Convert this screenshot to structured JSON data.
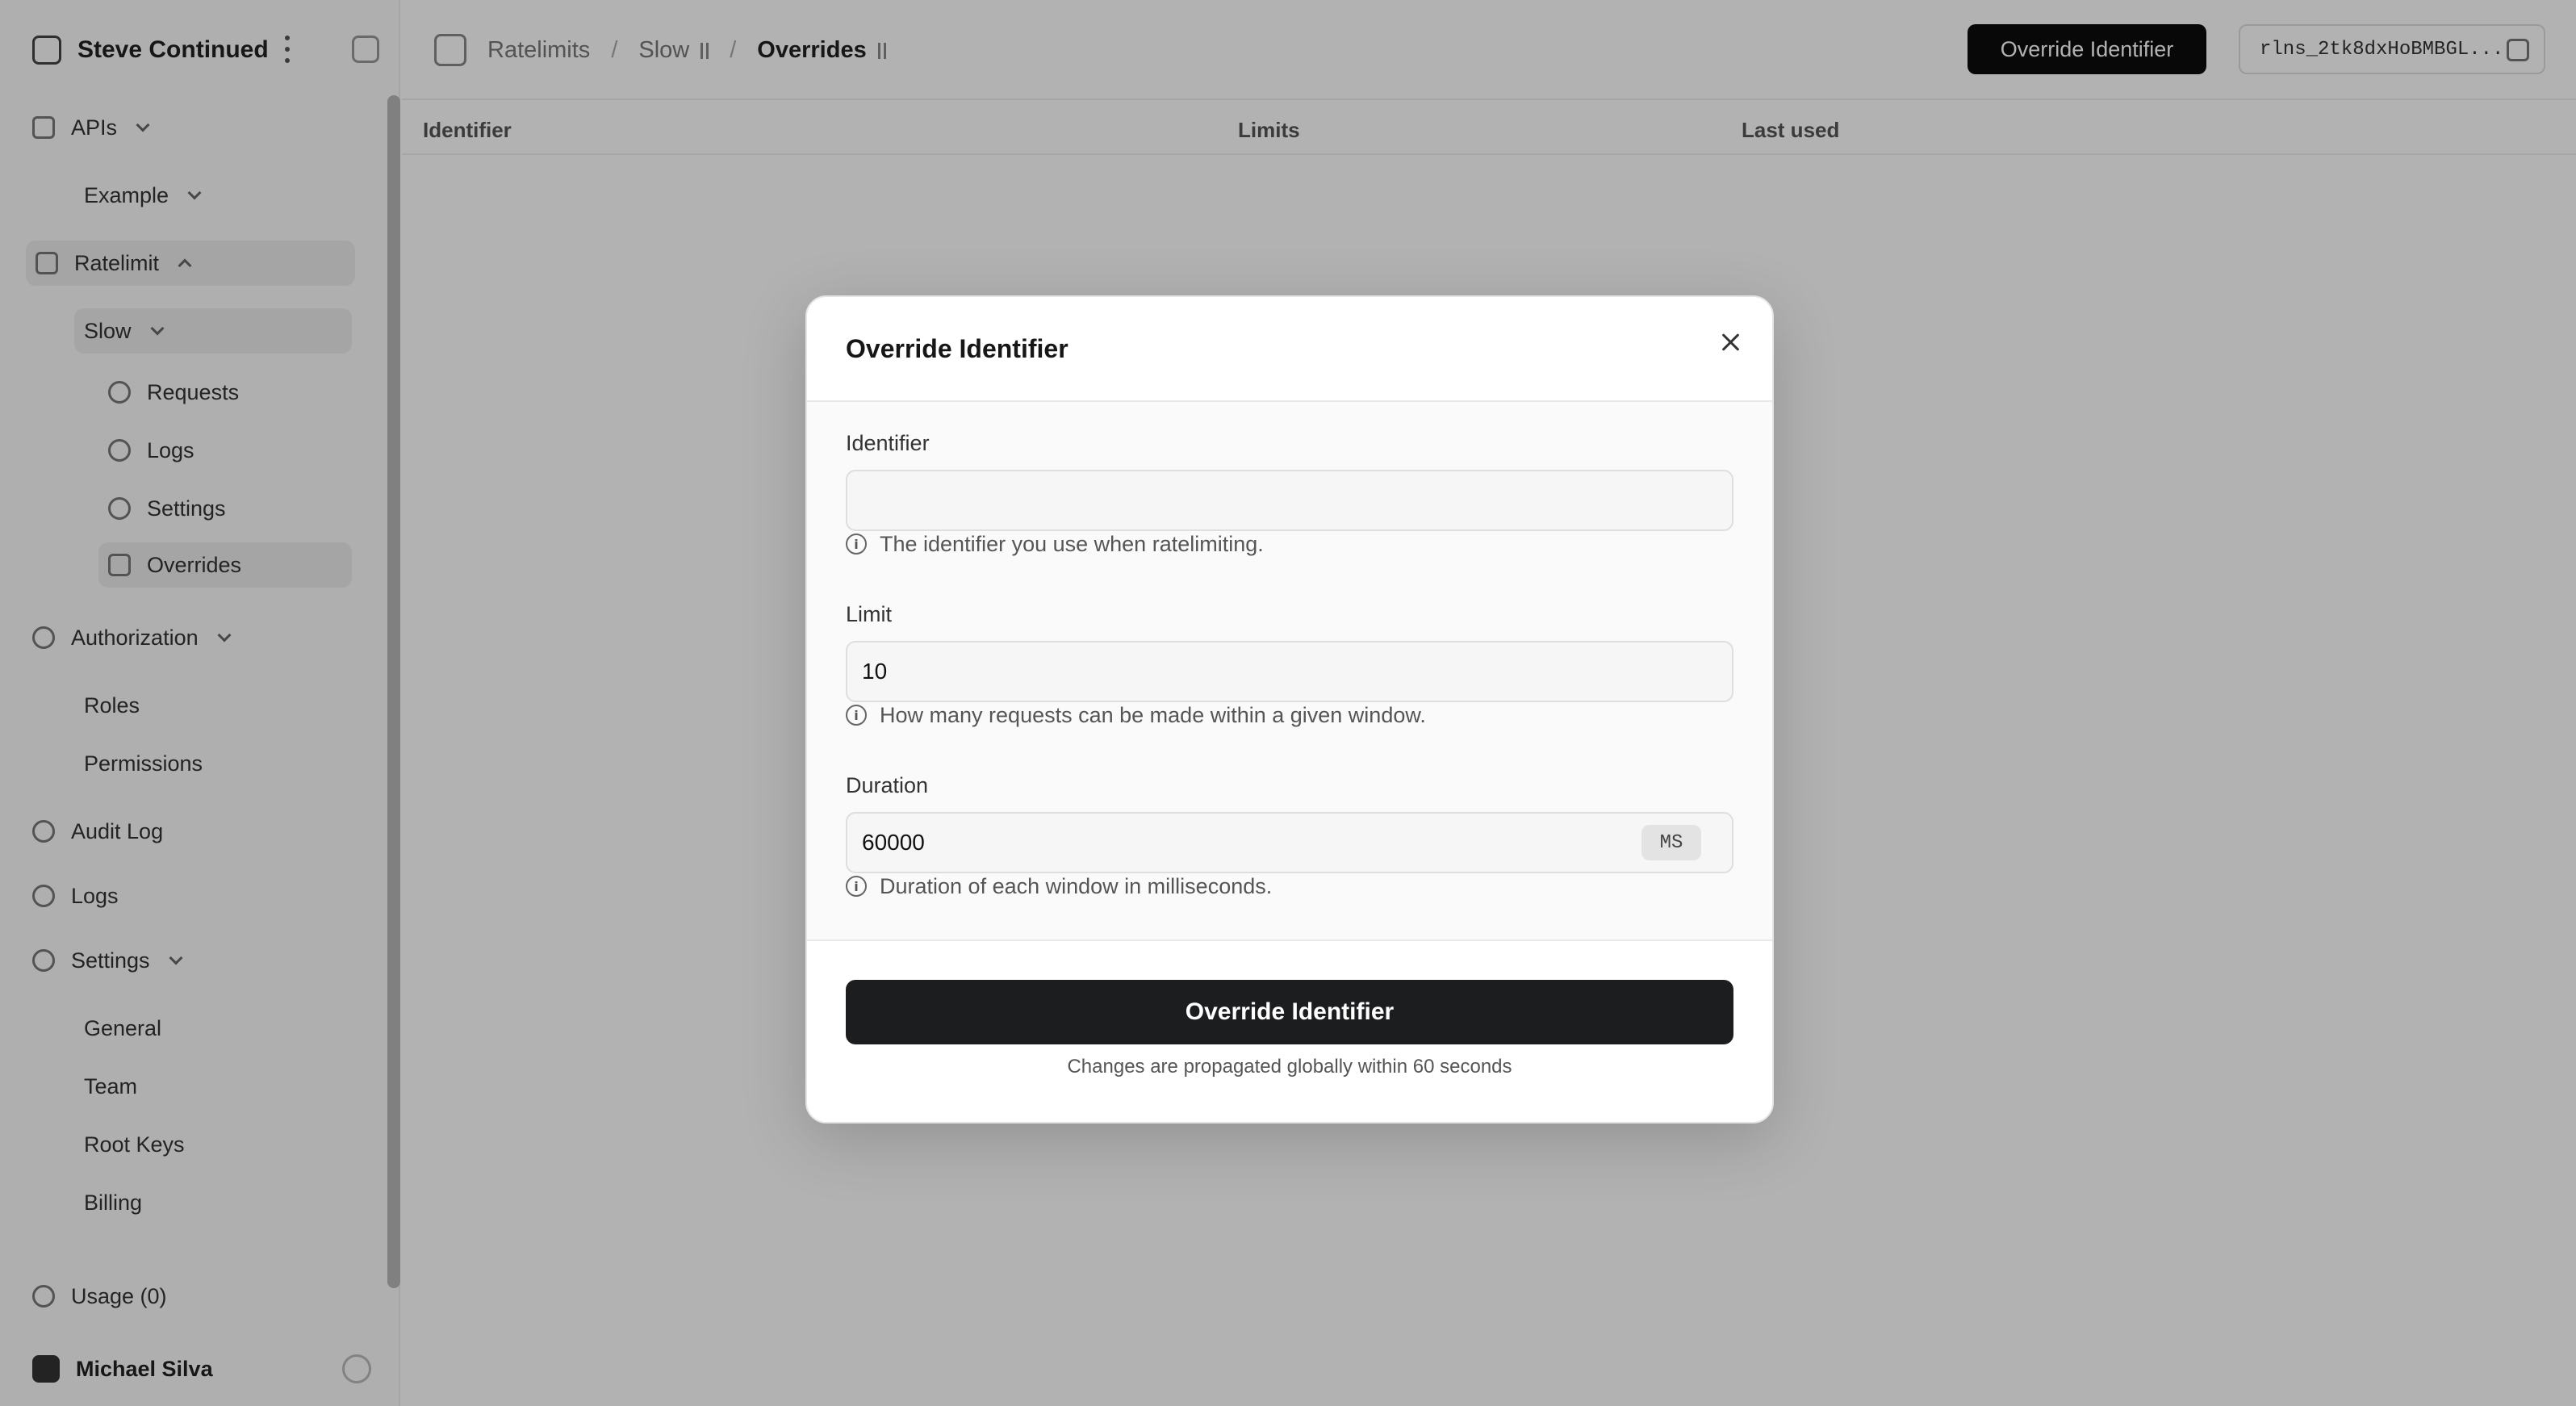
{
  "sidebar": {
    "workspace": "Steve Continued",
    "items": [
      {
        "label": "APIs"
      },
      {
        "label": "Example"
      },
      {
        "label": "Ratelimit"
      },
      {
        "label": "Slow"
      },
      {
        "label": "Requests"
      },
      {
        "label": "Logs"
      },
      {
        "label": "Settings"
      },
      {
        "label": "Overrides"
      },
      {
        "label": "Authorization"
      },
      {
        "label": "Roles"
      },
      {
        "label": "Permissions"
      },
      {
        "label": "Audit Log"
      },
      {
        "label": "Logs"
      },
      {
        "label": "Settings"
      },
      {
        "label": "General"
      },
      {
        "label": "Team"
      },
      {
        "label": "Root Keys"
      },
      {
        "label": "Billing"
      },
      {
        "label": "Usage (0)"
      }
    ],
    "user": "Michael Silva"
  },
  "header": {
    "breadcrumbs": [
      "Ratelimits",
      "Slow",
      "Overrides"
    ],
    "override_button": "Override Identifier",
    "namespace_id": "rlns_2tk8dxHoBMBGL..."
  },
  "table": {
    "columns": [
      "Identifier",
      "Limits",
      "Last used"
    ]
  },
  "modal": {
    "title": "Override Identifier",
    "identifier": {
      "label": "Identifier",
      "value": "",
      "hint": "The identifier you use when ratelimiting."
    },
    "limit": {
      "label": "Limit",
      "value": "10",
      "hint": "How many requests can be made within a given window."
    },
    "duration": {
      "label": "Duration",
      "value": "60000",
      "unit": "MS",
      "hint": "Duration of each window in milliseconds."
    },
    "submit_label": "Override Identifier",
    "footer_note": "Changes are propagated globally within 60 seconds"
  }
}
